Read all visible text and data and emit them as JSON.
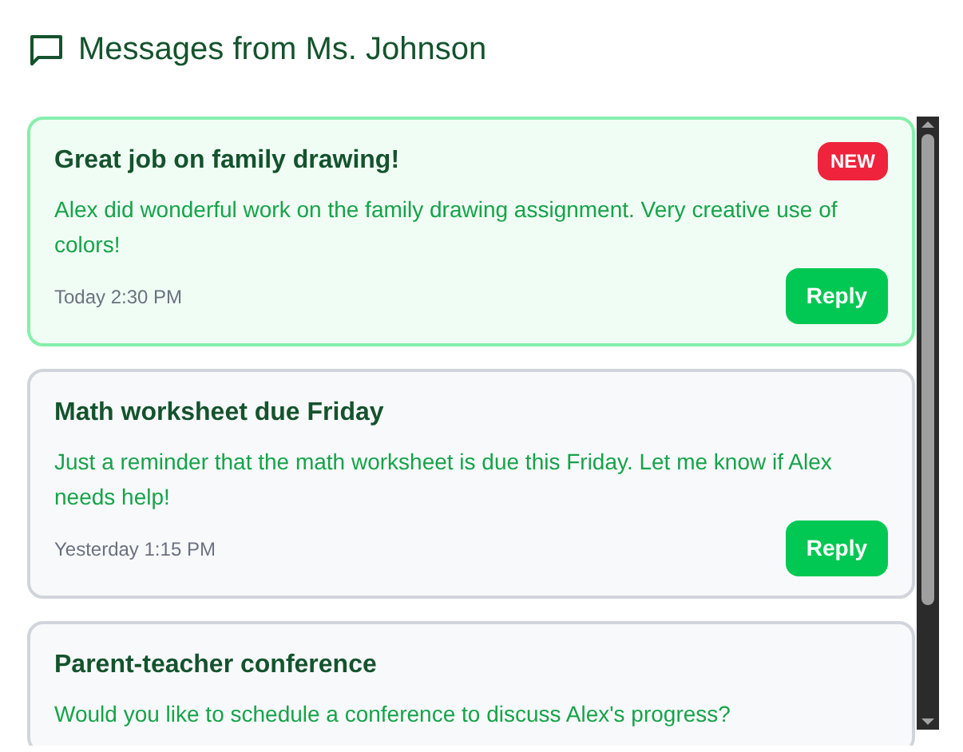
{
  "header": {
    "title": "Messages from Ms. Johnson"
  },
  "messages": [
    {
      "title": "Great job on family drawing!",
      "new": true,
      "badge": "NEW",
      "body": "Alex did wonderful work on the family drawing assignment. Very creative use of colors!",
      "time": "Today 2:30 PM",
      "action": "Reply"
    },
    {
      "title": "Math worksheet due Friday",
      "new": false,
      "body": "Just a reminder that the math worksheet is due this Friday. Let me know if Alex needs help!",
      "time": "Yesterday 1:15 PM",
      "action": "Reply"
    },
    {
      "title": "Parent-teacher conference",
      "new": false,
      "body": "Would you like to schedule a conference to discuss Alex's progress?"
    }
  ]
}
